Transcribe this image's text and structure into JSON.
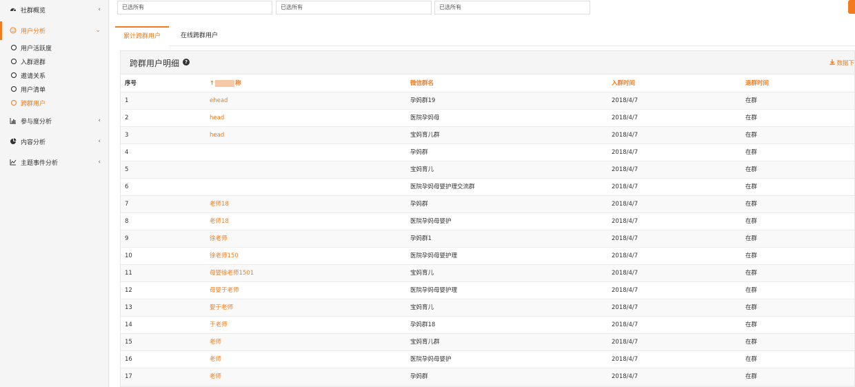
{
  "sidebar": {
    "items": [
      {
        "label": "社群概览",
        "icon": "dashboard-icon",
        "chevron": "‹"
      },
      {
        "label": "用户分析",
        "icon": "smile-icon",
        "chevron": "⌄"
      },
      {
        "label": "参与度分析",
        "icon": "bar-chart-icon",
        "chevron": "‹"
      },
      {
        "label": "内容分析",
        "icon": "pie-chart-icon",
        "chevron": "‹"
      },
      {
        "label": "主题事件分析",
        "icon": "line-chart-icon",
        "chevron": "‹"
      }
    ],
    "sub_items": [
      {
        "label": "用户活跃度"
      },
      {
        "label": "入群退群"
      },
      {
        "label": "邀请关系"
      },
      {
        "label": "用户清单"
      },
      {
        "label": "跨群用户"
      }
    ]
  },
  "filters": [
    {
      "value": "已选所有"
    },
    {
      "value": "已选所有"
    },
    {
      "value": "已选所有"
    }
  ],
  "tabs": [
    {
      "label": "累计跨群用户"
    },
    {
      "label": "在线跨群用户"
    }
  ],
  "panel": {
    "title": "跨群用户明细",
    "export_label": "数据下"
  },
  "table": {
    "headers": [
      "序号",
      "称",
      "微信群名",
      "入群时间",
      "退群时间"
    ],
    "rows": [
      [
        "1",
        "ehead",
        "孕妈群19",
        "2018/4/7",
        "在群"
      ],
      [
        "2",
        "head",
        "医院孕妈母",
        "2018/4/7",
        "在群"
      ],
      [
        "3",
        "head",
        "宝妈育儿群",
        "2018/4/7",
        "在群"
      ],
      [
        "4",
        "",
        "孕妈群",
        "2018/4/7",
        "在群"
      ],
      [
        "5",
        "",
        "宝妈育儿",
        "2018/4/7",
        "在群"
      ],
      [
        "6",
        "",
        "医院孕妈母婴护理交流群",
        "2018/4/7",
        "在群"
      ],
      [
        "7",
        "老师18",
        "孕妈群",
        "2018/4/7",
        "在群"
      ],
      [
        "8",
        "老师18",
        "医院孕妈母婴护",
        "2018/4/7",
        "在群"
      ],
      [
        "9",
        "徐老师",
        "孕妈群1",
        "2018/4/7",
        "在群"
      ],
      [
        "10",
        "徐老师150",
        "医院孕妈母婴护理",
        "2018/4/7",
        "在群"
      ],
      [
        "11",
        "母婴徐老师1501",
        "宝妈育儿",
        "2018/4/7",
        "在群"
      ],
      [
        "12",
        "母婴于老师",
        "医院孕妈母婴护理",
        "2018/4/7",
        "在群"
      ],
      [
        "13",
        "婴于老师",
        "宝妈育儿",
        "2018/4/7",
        "在群"
      ],
      [
        "14",
        "于老师",
        "孕妈群18",
        "2018/4/7",
        "在群"
      ],
      [
        "15",
        "老师",
        "宝妈育儿群",
        "2018/4/7",
        "在群"
      ],
      [
        "16",
        "老师",
        "医院孕妈母婴护",
        "2018/4/7",
        "在群"
      ],
      [
        "17",
        "老师",
        "孕妈群",
        "2018/4/7",
        "在群"
      ]
    ]
  }
}
